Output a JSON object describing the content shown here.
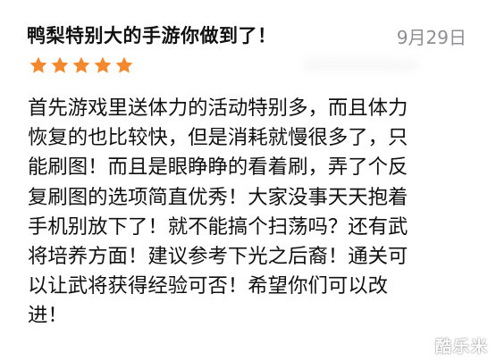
{
  "review": {
    "title": "鸭梨特别大的手游你做到了！",
    "date": "9月29日",
    "rating": 5,
    "reviewer": "•••••••••••",
    "body": "首先游戏里送体力的活动特别多，而且体力\n恢复的也比较快，但是消耗就慢很多了，只\n能刷图！而且是眼睁睁的看着刷，弄了个反\n复刷图的选项简直优秀！大家没事天天抱着\n手机别放下了！就不能搞个扫荡吗？还有武\n将培养方面！建议参考下光之后裔！通关可\n以让武将获得经验可否！希望你们可以改\n进！"
  },
  "watermark": "酷乐米",
  "colors": {
    "star": "#f3882c",
    "date": "#8e8e93",
    "text": "#111111"
  }
}
